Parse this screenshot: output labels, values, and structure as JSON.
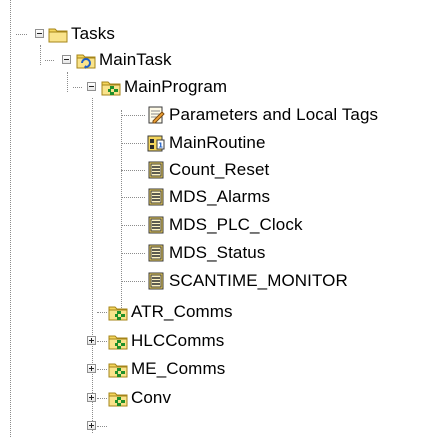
{
  "tree": {
    "tasks": {
      "label": "Tasks",
      "icon": "folder-icon"
    },
    "main_task": {
      "label": "MainTask",
      "icon": "continuous-task-icon"
    },
    "main_program": {
      "label": "MainProgram",
      "icon": "program-folder-icon"
    },
    "program_items": [
      {
        "label": "Parameters and Local Tags",
        "icon": "tags-icon"
      },
      {
        "label": "MainRoutine",
        "icon": "main-routine-icon"
      },
      {
        "label": "Count_Reset",
        "icon": "ladder-routine-icon"
      },
      {
        "label": "MDS_Alarms",
        "icon": "ladder-routine-icon"
      },
      {
        "label": "MDS_PLC_Clock",
        "icon": "ladder-routine-icon"
      },
      {
        "label": "MDS_Status",
        "icon": "ladder-routine-icon"
      },
      {
        "label": "SCANTIME_MONITOR",
        "icon": "ladder-routine-icon"
      }
    ],
    "collapsed_programs": [
      {
        "label": "ATR_Comms",
        "icon": "program-folder-icon"
      },
      {
        "label": "HLCComms",
        "icon": "program-folder-icon"
      },
      {
        "label": "ME_Comms",
        "icon": "program-folder-icon"
      },
      {
        "label": "Conv",
        "icon": "program-folder-icon"
      }
    ]
  },
  "colors": {
    "folder_fill": "#f4d55c",
    "folder_stroke": "#a58418",
    "program_green": "#1f8f2a",
    "tree_line": "#8c8c8c",
    "routine_stroke": "#3a3a3a"
  }
}
